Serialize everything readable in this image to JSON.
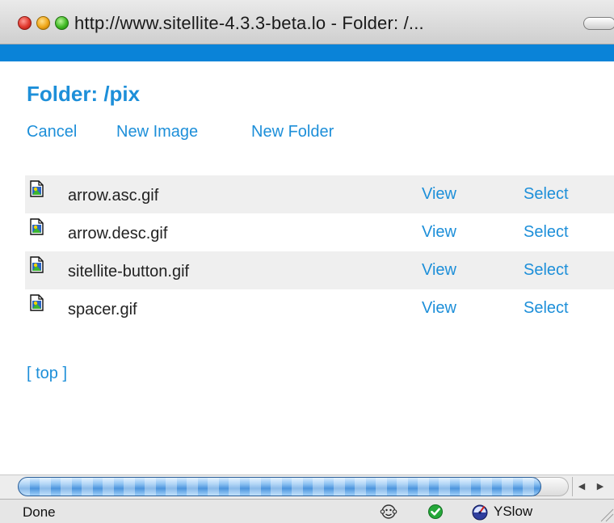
{
  "window": {
    "title": "http://www.sitellite-4.3.3-beta.lo - Folder: /..."
  },
  "page": {
    "title": "Folder: /pix",
    "actions": {
      "cancel": "Cancel",
      "new_image": "New Image",
      "new_folder": "New Folder"
    },
    "files": [
      {
        "name": "arrow.asc.gif",
        "view": "View",
        "select": "Select"
      },
      {
        "name": "arrow.desc.gif",
        "view": "View",
        "select": "Select"
      },
      {
        "name": "sitellite-button.gif",
        "view": "View",
        "select": "Select"
      },
      {
        "name": "spacer.gif",
        "view": "View",
        "select": "Select"
      }
    ],
    "top_link": "[ top ]"
  },
  "statusbar": {
    "status": "Done",
    "yslow": "YSlow"
  },
  "icons": {
    "file": "image-file-icon",
    "status_face": "monkey-face-icon",
    "status_ok": "checkmark-circle-icon",
    "yslow": "speedometer-icon"
  },
  "colors": {
    "accent": "#1d8fd9",
    "band": "#0a83d8",
    "row_shade": "#efefef"
  }
}
